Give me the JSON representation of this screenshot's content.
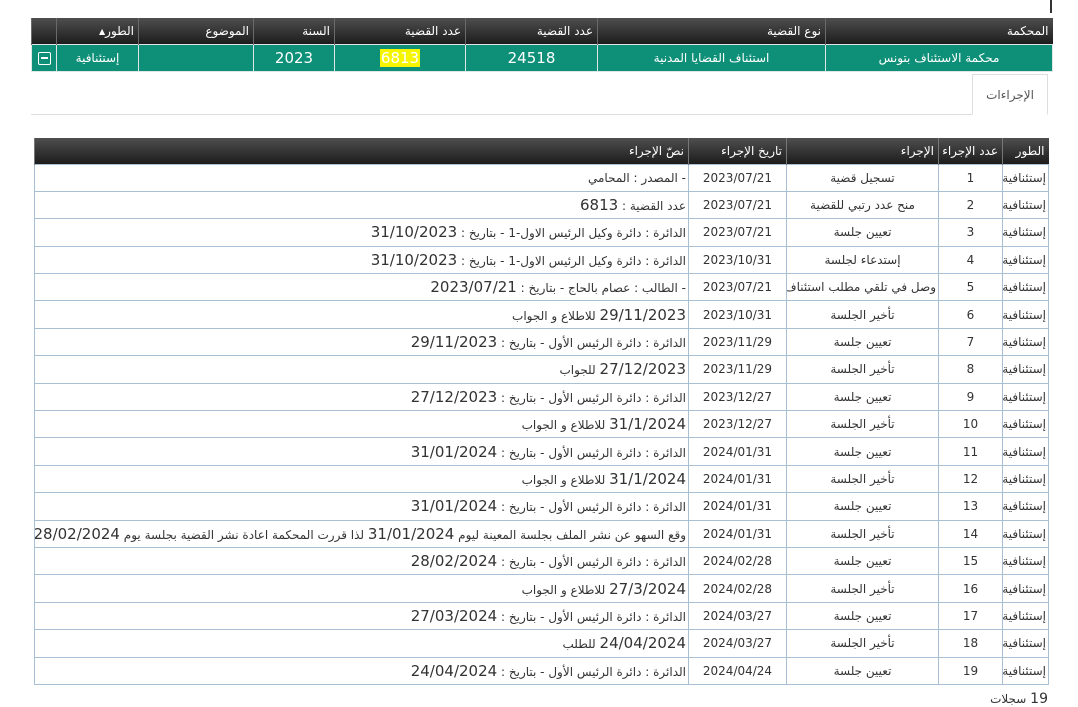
{
  "case_header": {
    "columns": {
      "court": "المحكمة",
      "case_type": "نوع القضية",
      "case_number": "عدد القضية",
      "case_number_2": "عدد القضية",
      "year": "السنة",
      "subject": "الموضوع",
      "stage": "الطور"
    },
    "row": {
      "court": "محكمة الاستئناف بتونس",
      "case_type": "استئناف القضايا المدنية",
      "case_number": "24518",
      "case_number_2": "6813",
      "year": "2023",
      "subject": "",
      "stage": "إستئنافية"
    }
  },
  "tabs": {
    "procedures": "الإجراءات"
  },
  "procedures_table": {
    "columns": {
      "stage": "الطور",
      "number": "عدد الإجراء",
      "procedure": "الإجراء",
      "date": "تاريخ الإجراء",
      "text": "نصّ الإجراء"
    },
    "rows": [
      {
        "stage": "إستئنافية",
        "number": "1",
        "procedure": "تسجيل قضية",
        "date": "2023/07/21",
        "text_a": "- المصدر : المحامي",
        "text_b": "",
        "text_c": ""
      },
      {
        "stage": "إستئنافية",
        "number": "2",
        "procedure": "منح عدد رتبي للقضية",
        "date": "2023/07/21",
        "text_a": "عدد القضية :",
        "text_b": "6813",
        "text_c": ""
      },
      {
        "stage": "إستئنافية",
        "number": "3",
        "procedure": "تعيين جلسة",
        "date": "2023/07/21",
        "text_a": "الدائرة : دائرة وكيل الرئيس الاول-1 - بتاريخ :",
        "text_b": "31/10/2023",
        "text_c": ""
      },
      {
        "stage": "إستئنافية",
        "number": "4",
        "procedure": "إستدعاء لجلسة",
        "date": "2023/10/31",
        "text_a": "الدائرة : دائرة وكيل الرئيس الاول-1 - بتاريخ :",
        "text_b": "31/10/2023",
        "text_c": ""
      },
      {
        "stage": "إستئنافية",
        "number": "5",
        "procedure": "وصل في تلقي مطلب استئناف",
        "date": "2023/07/21",
        "text_a": "- الطالب : عصام بالحاج - بتاريخ :",
        "text_b": "2023/07/21",
        "text_c": ""
      },
      {
        "stage": "إستئنافية",
        "number": "6",
        "procedure": "تأخير الجلسة",
        "date": "2023/10/31",
        "text_a": "",
        "text_b": "29/11/2023",
        "text_c": "للاطلاع و الجواب"
      },
      {
        "stage": "إستئنافية",
        "number": "7",
        "procedure": "تعيين جلسة",
        "date": "2023/11/29",
        "text_a": "الدائرة : دائرة الرئيس الأول - بتاريخ :",
        "text_b": "29/11/2023",
        "text_c": ""
      },
      {
        "stage": "إستئنافية",
        "number": "8",
        "procedure": "تأخير الجلسة",
        "date": "2023/11/29",
        "text_a": "",
        "text_b": "27/12/2023",
        "text_c": "للجواب"
      },
      {
        "stage": "إستئنافية",
        "number": "9",
        "procedure": "تعيين جلسة",
        "date": "2023/12/27",
        "text_a": "الدائرة : دائرة الرئيس الأول - بتاريخ :",
        "text_b": "27/12/2023",
        "text_c": ""
      },
      {
        "stage": "إستئنافية",
        "number": "10",
        "procedure": "تأخير الجلسة",
        "date": "2023/12/27",
        "text_a": "",
        "text_b": "31/1/2024",
        "text_c": "للاطلاع و الجواب"
      },
      {
        "stage": "إستئنافية",
        "number": "11",
        "procedure": "تعيين جلسة",
        "date": "2024/01/31",
        "text_a": "الدائرة : دائرة الرئيس الأول - بتاريخ :",
        "text_b": "31/01/2024",
        "text_c": ""
      },
      {
        "stage": "إستئنافية",
        "number": "12",
        "procedure": "تأخير الجلسة",
        "date": "2024/01/31",
        "text_a": "",
        "text_b": "31/1/2024",
        "text_c": "للاطلاع و الجواب"
      },
      {
        "stage": "إستئنافية",
        "number": "13",
        "procedure": "تعيين جلسة",
        "date": "2024/01/31",
        "text_a": "الدائرة : دائرة الرئيس الأول - بتاريخ :",
        "text_b": "31/01/2024",
        "text_c": ""
      },
      {
        "stage": "إستئنافية",
        "number": "14",
        "procedure": "تأخير الجلسة",
        "date": "2024/01/31",
        "text_a": "وقع السهو عن نشر الملف بجلسة المعينة ليوم",
        "text_b": "31/01/2024",
        "text_c": "لذا قررت المحكمة اعادة نشر القضية بجلسة يوم",
        "text_d": "28/02/2024"
      },
      {
        "stage": "إستئنافية",
        "number": "15",
        "procedure": "تعيين جلسة",
        "date": "2024/02/28",
        "text_a": "الدائرة : دائرة الرئيس الأول - بتاريخ :",
        "text_b": "28/02/2024",
        "text_c": ""
      },
      {
        "stage": "إستئنافية",
        "number": "16",
        "procedure": "تأخير الجلسة",
        "date": "2024/02/28",
        "text_a": "",
        "text_b": "27/3/2024",
        "text_c": "للاطلاع و الجواب"
      },
      {
        "stage": "إستئنافية",
        "number": "17",
        "procedure": "تعيين جلسة",
        "date": "2024/03/27",
        "text_a": "الدائرة : دائرة الرئيس الأول - بتاريخ :",
        "text_b": "27/03/2024",
        "text_c": ""
      },
      {
        "stage": "إستئنافية",
        "number": "18",
        "procedure": "تأخير الجلسة",
        "date": "2024/03/27",
        "text_a": "",
        "text_b": "24/04/2024",
        "text_c": "للطلب"
      },
      {
        "stage": "إستئنافية",
        "number": "19",
        "procedure": "تعيين جلسة",
        "date": "2024/04/24",
        "text_a": "الدائرة : دائرة الرئيس الأول - بتاريخ :",
        "text_b": "24/04/2024",
        "text_c": ""
      }
    ]
  },
  "record_count": {
    "value": "19",
    "label": "سجلات"
  }
}
